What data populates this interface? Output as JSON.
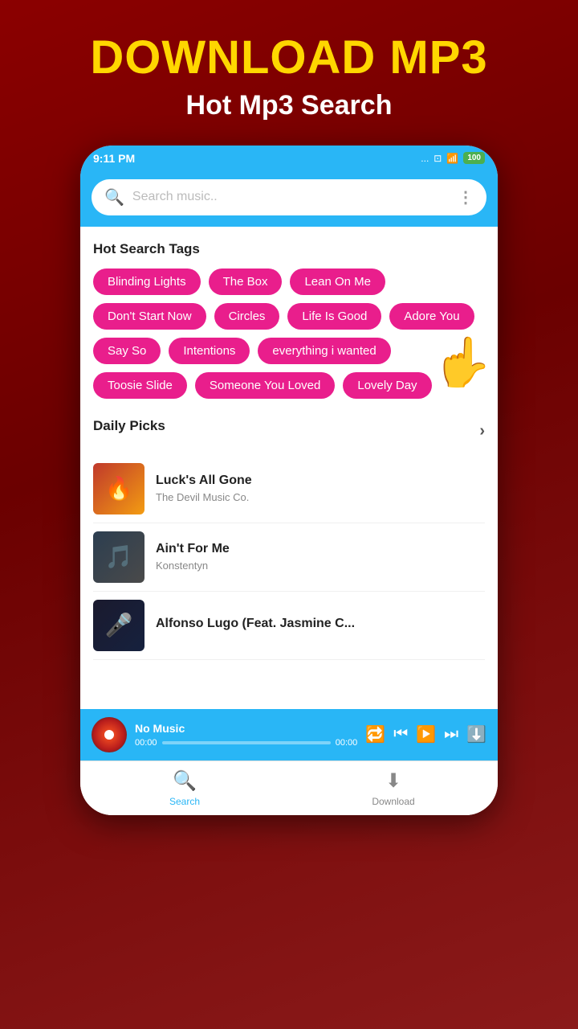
{
  "header": {
    "headline": "DOWNLOAD MP3",
    "subtitle": "Hot Mp3 Search"
  },
  "statusBar": {
    "time": "9:11 PM",
    "dots": "...",
    "battery": "100"
  },
  "searchBar": {
    "placeholder": "Search music.."
  },
  "hotSearchTags": {
    "sectionTitle": "Hot Search Tags",
    "tags": [
      "Blinding Lights",
      "The Box",
      "Lean On Me",
      "Don't Start Now",
      "Circles",
      "Life Is Good",
      "Adore You",
      "Say So",
      "Intentions",
      "everything i wanted",
      "Toosie Slide",
      "Someone You Loved",
      "Lovely Day"
    ]
  },
  "dailyPicks": {
    "sectionTitle": "Daily Picks",
    "arrowLabel": "›",
    "songs": [
      {
        "title": "Luck's All Gone",
        "artist": "The Devil Music Co.",
        "thumbEmoji": "🔥"
      },
      {
        "title": "Ain't For Me",
        "artist": "Konstentyn",
        "thumbEmoji": "🎵"
      },
      {
        "title": "Alfonso Lugo (Feat. Jasmine C...",
        "artist": "",
        "thumbEmoji": "🎤"
      }
    ]
  },
  "nowPlaying": {
    "title": "No Music",
    "timeStart": "00:00",
    "timeEnd": "00:00"
  },
  "bottomNav": {
    "items": [
      {
        "label": "Search",
        "icon": "🔍",
        "active": true
      },
      {
        "label": "Download",
        "icon": "⬇",
        "active": false
      }
    ]
  }
}
